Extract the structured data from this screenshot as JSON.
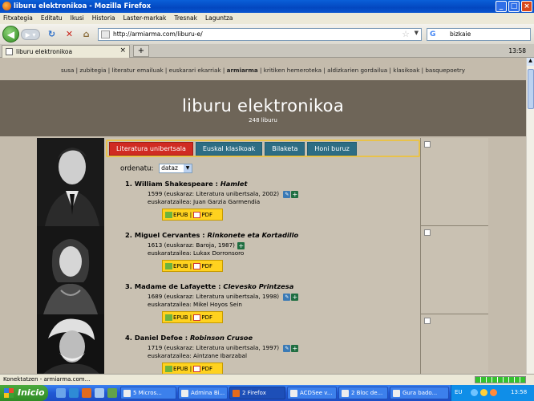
{
  "window": {
    "title": "liburu elektronikoa - Mozilla Firefox"
  },
  "menu": [
    "Fitxategia",
    "Editatu",
    "Ikusi",
    "Historia",
    "Laster-markak",
    "Tresnak",
    "Laguntza"
  ],
  "nav": {
    "url": "http://armiarma.com/liburu-e/",
    "search": "bizkaie"
  },
  "tab": {
    "label": "liburu elektronikoa",
    "time": "13:58"
  },
  "site": {
    "links": [
      "susa",
      "zubitegia",
      "literatur emailuak",
      "euskarari ekarriak",
      "armiarma",
      "kritiken hemeroteka",
      "aldizkarien gordailua",
      "klasikoak",
      "basquepoetry"
    ],
    "active_link": "armiarma",
    "title": "liburu elektronikoa",
    "count": "248 liburu",
    "tabs": [
      "Literatura unibertsala",
      "Euskal klasikoak",
      "Bilaketa",
      "Honi buruz"
    ],
    "sort_label": "ordenatu:",
    "sort_value": "dataz",
    "books": [
      {
        "num": "1.",
        "author": "William Shakespeare : ",
        "title": "Hamlet",
        "meta": "1599 (euskaraz: Literatura unibertsala, 2002)",
        "translator": "euskaratzailea: Juan Garzia Garmendia",
        "edit": true
      },
      {
        "num": "2.",
        "author": "Miguel Cervantes : ",
        "title": "Rinkonete eta Kortadillo",
        "meta": "1613 (euskaraz: Baroja, 1987)",
        "translator": "euskaratzailea: Lukax Dorronsoro",
        "edit": false
      },
      {
        "num": "3.",
        "author": "Madame de Lafayette : ",
        "title": "Clevesko Printzesa",
        "meta": "1689 (euskaraz: Literatura unibertsala, 1998)",
        "translator": "euskaratzailea: Mikel Hoyos Sein",
        "edit": true
      },
      {
        "num": "4.",
        "author": "Daniel Defoe : ",
        "title": "Robinson Crusoe",
        "meta": "1719 (euskaraz: Literatura unibertsala, 1997)",
        "translator": "euskaratzailea: Aintzane Ibarzabal",
        "edit": true
      }
    ],
    "epub": "EPUB",
    "pdf": "PDF"
  },
  "status": "Konektatzen - armiarma.com...",
  "taskbar": {
    "start": "Inicio",
    "items": [
      "5 Micros...",
      "Admina Bi...",
      "2 Firefox",
      "ACDSee v...",
      "2 Bloc de...",
      "Gura bado..."
    ],
    "lang": "EU",
    "clock": "13:58"
  },
  "colors": {
    "header": "#6e6558",
    "page_bg": "#c4bbac",
    "active_tab": "#d02b22",
    "tab": "#2d6d84",
    "download": "#ffd21f"
  }
}
